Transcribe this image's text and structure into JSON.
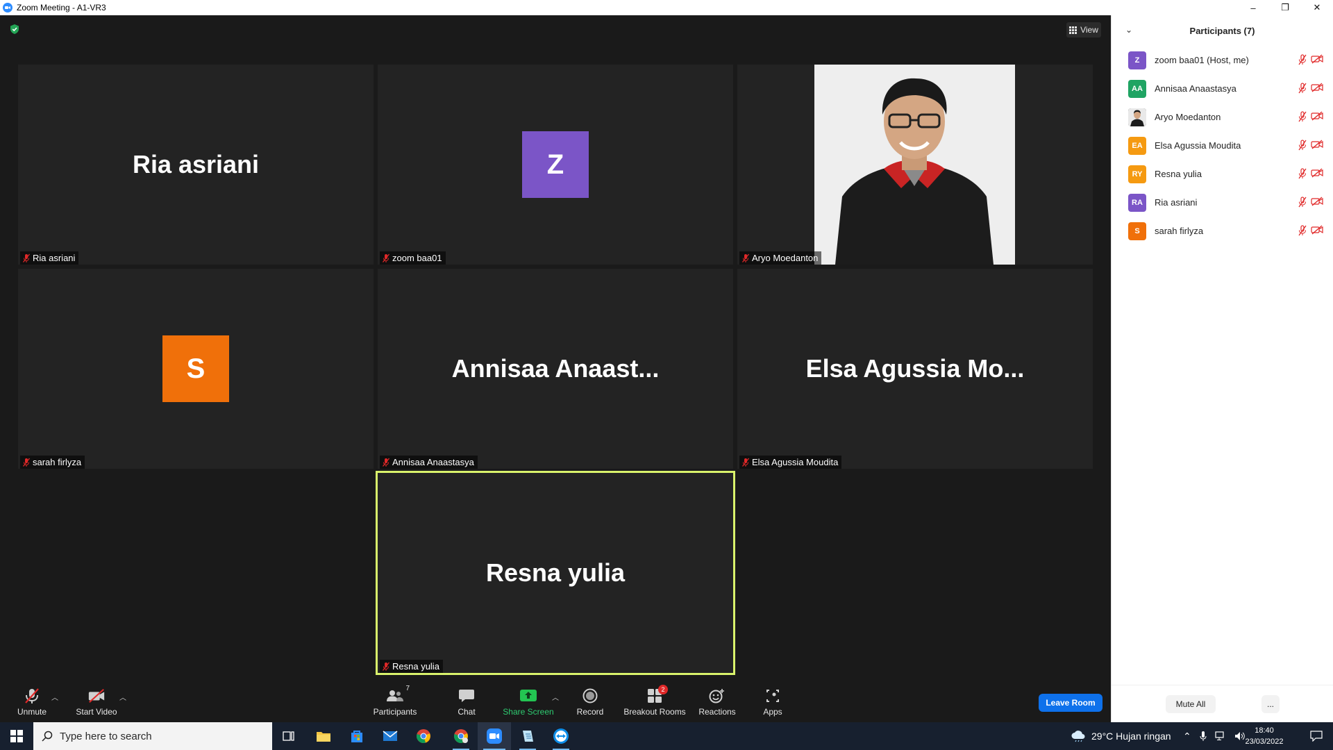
{
  "window": {
    "title": "Zoom Meeting - A1-VR3",
    "minimize": "–",
    "restore": "❐",
    "close": "✕"
  },
  "meeting": {
    "view_label": "View",
    "tiles": [
      {
        "name": "Ria asriani",
        "big": "Ria asriani",
        "type": "name"
      },
      {
        "name": "zoom baa01",
        "big": "Z",
        "type": "avatar",
        "color": "#7b55c7"
      },
      {
        "name": "Aryo Moedanton",
        "type": "video"
      },
      {
        "name": "sarah firlyza",
        "big": "S",
        "type": "avatar",
        "color": "#f0700a"
      },
      {
        "name": "Annisaa Anaastasya",
        "big": "Annisaa  Anaast...",
        "type": "name"
      },
      {
        "name": "Elsa Agussia Moudita",
        "big": "Elsa  Agussia  Mo...",
        "type": "name"
      },
      {
        "name": "Resna yulia",
        "big": "Resna yulia",
        "type": "name",
        "active": true
      }
    ]
  },
  "toolbar": {
    "unmute": "Unmute",
    "start_video": "Start Video",
    "participants": "Participants",
    "participants_count": "7",
    "chat": "Chat",
    "share_screen": "Share Screen",
    "record": "Record",
    "breakout_rooms": "Breakout Rooms",
    "breakout_badge": "2",
    "reactions": "Reactions",
    "apps": "Apps",
    "leave_room": "Leave Room"
  },
  "panel": {
    "title": "Participants (7)",
    "participants": [
      {
        "initials": "Z",
        "name": "zoom baa01 (Host, me)",
        "color": "#7b55c7"
      },
      {
        "initials": "AA",
        "name": "Annisaa Anaastasya",
        "color": "#1fa463"
      },
      {
        "initials": "",
        "name": "Aryo Moedanton",
        "color": "#333333",
        "photo": true
      },
      {
        "initials": "EA",
        "name": "Elsa Agussia Moudita",
        "color": "#f59a11"
      },
      {
        "initials": "RY",
        "name": "Resna yulia",
        "color": "#f59a11"
      },
      {
        "initials": "RA",
        "name": "Ria asriani",
        "color": "#7b55c7"
      },
      {
        "initials": "S",
        "name": "sarah firlyza",
        "color": "#f0700a"
      }
    ],
    "mute_all": "Mute All",
    "more": "..."
  },
  "taskbar": {
    "search_placeholder": "Type here to search",
    "weather": "29°C  Hujan ringan",
    "time": "18:40",
    "date": "23/03/2022"
  },
  "colors": {
    "accent": "#0e71eb",
    "active_speaker": "#d9f26b",
    "muted": "#e02828"
  }
}
